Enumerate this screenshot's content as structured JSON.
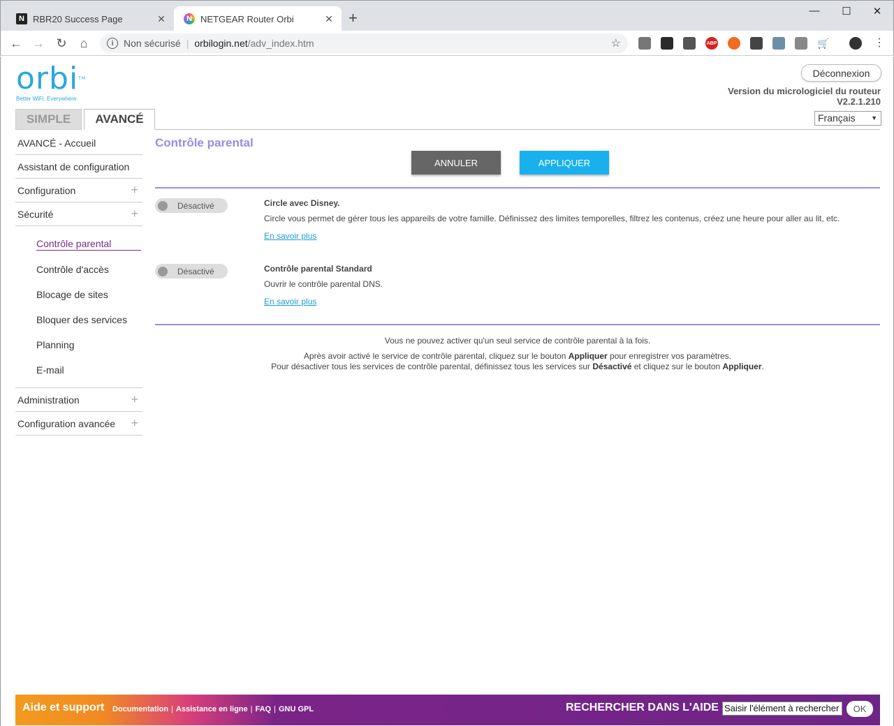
{
  "browser": {
    "tabs": [
      {
        "title": "RBR20 Success Page",
        "favicon": "N",
        "close": "✕"
      },
      {
        "title": "NETGEAR Router Orbi",
        "favicon": "N",
        "close": "✕"
      }
    ],
    "new_tab": "+",
    "window_controls": {
      "minimize": "—",
      "maximize": "☐",
      "close": "✕"
    },
    "address": {
      "security": "Non sécurisé",
      "host": "orbilogin.net",
      "path": "/adv_index.htm"
    },
    "extensions": [
      "puzzle-icon",
      "ghostery-icon",
      "key-icon",
      "adblock-icon",
      "grammarly-icon",
      "lock-icon",
      "shield-icon",
      "gmail-icon",
      "cart-icon",
      "avatar-icon",
      "menu-icon"
    ],
    "ext_abp_label": "ABP"
  },
  "header": {
    "logo_word": "orbi",
    "logo_tm": "TM",
    "logo_tagline": "Better WiFi. Everywhere.",
    "logout": "Déconnexion",
    "firmware_label": "Version du micrologiciel du routeur",
    "firmware_version": "V2.2.1.210",
    "language": "Français",
    "tabs": {
      "simple": "SIMPLE",
      "advanced": "AVANCÉ"
    }
  },
  "sidebar": {
    "items": [
      {
        "label": "AVANCÉ - Accueil",
        "expandable": false
      },
      {
        "label": "Assistant de configuration",
        "expandable": false
      },
      {
        "label": "Configuration",
        "expandable": true
      },
      {
        "label": "Sécurité",
        "expandable": true
      }
    ],
    "security_sub": [
      {
        "label": "Contrôle parental",
        "active": true
      },
      {
        "label": "Contrôle d'accès",
        "active": false
      },
      {
        "label": "Blocage de sites",
        "active": false
      },
      {
        "label": "Bloquer des services",
        "active": false
      },
      {
        "label": "Planning",
        "active": false
      },
      {
        "label": "E-mail",
        "active": false
      }
    ],
    "bottom_items": [
      {
        "label": "Administration",
        "expandable": true
      },
      {
        "label": "Configuration avancée",
        "expandable": true
      }
    ],
    "plus": "+"
  },
  "main": {
    "title": "Contrôle parental",
    "cancel": "ANNULER",
    "apply": "APPLIQUER",
    "services": [
      {
        "toggle": "Désactivé",
        "title": "Circle avec Disney.",
        "description": "Circle vous permet de gérer tous les appareils de votre famille. Définissez des limites temporelles, filtrez les contenus, créez une heure pour aller au lit, etc.",
        "link": "En savoir plus"
      },
      {
        "toggle": "Désactivé",
        "title": "Contrôle parental Standard",
        "description": "Ouvrir le contrôle parental DNS.",
        "link": "En savoir plus"
      }
    ],
    "note1": "Vous ne pouvez activer qu'un seul service de contrôle parental à la fois.",
    "note2_a": "Après avoir activé le service de contrôle parental, cliquez sur le bouton ",
    "note2_b": "Appliquer",
    "note2_c": " pour enregistrer vos paramètres.",
    "note3_a": "Pour désactiver tous les services de contrôle parental, définissez tous les services sur ",
    "note3_b": "Désactivé",
    "note3_c": " et cliquez sur le bouton ",
    "note3_d": "Appliquer",
    "note3_e": "."
  },
  "footer": {
    "title": "Aide et support",
    "links": [
      "Documentation",
      "Assistance en ligne",
      "FAQ",
      "GNU GPL"
    ],
    "separator": "|",
    "search_label": "RECHERCHER DANS L'AIDE",
    "search_value": "Saisir l'élément à rechercher",
    "ok": "OK"
  },
  "colors": {
    "accent_purple": "#9a8be6",
    "apply_blue": "#1ab0ee",
    "orbi_blue": "#29a8e0",
    "active_link": "#7b2a8c"
  }
}
